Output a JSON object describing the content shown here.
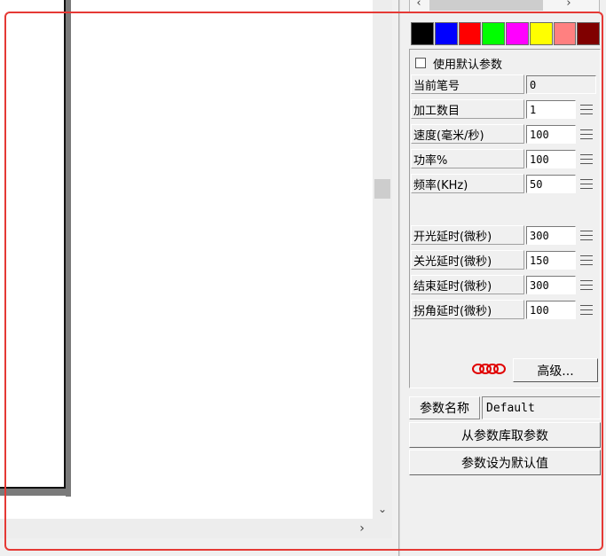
{
  "colors": {
    "swatches": [
      "#000000",
      "#0000ff",
      "#ff0000",
      "#00ff00",
      "#ff00ff",
      "#ffff00",
      "#ff8080",
      "#800000"
    ],
    "annotation": "#e53935"
  },
  "top_scrollbar": {
    "left_arrow": "‹",
    "right_arrow": "›"
  },
  "scrollbars": {
    "down_arrow": "⌄",
    "right_arrow": "›"
  },
  "pen": {
    "use_default_label": "使用默认参数",
    "use_default_checked": false,
    "params": [
      {
        "label": "当前笔号",
        "value": "0",
        "readonly": true
      },
      {
        "label": "加工数目",
        "value": "1"
      },
      {
        "label": "速度(毫米/秒)",
        "value": "100"
      },
      {
        "label": "功率%",
        "value": "100"
      },
      {
        "label": "频率(KHz)",
        "value": "50"
      }
    ],
    "delays": [
      {
        "label": "开光延时(微秒)",
        "value": "300"
      },
      {
        "label": "关光延时(微秒)",
        "value": "150"
      },
      {
        "label": "结束延时(微秒)",
        "value": "300"
      },
      {
        "label": "拐角延时(微秒)",
        "value": "100"
      }
    ],
    "advanced_label": "高级..."
  },
  "param_name": {
    "label": "参数名称",
    "value": "Default"
  },
  "buttons": {
    "load_from_library": "从参数库取参数",
    "set_as_default": "参数设为默认值"
  }
}
